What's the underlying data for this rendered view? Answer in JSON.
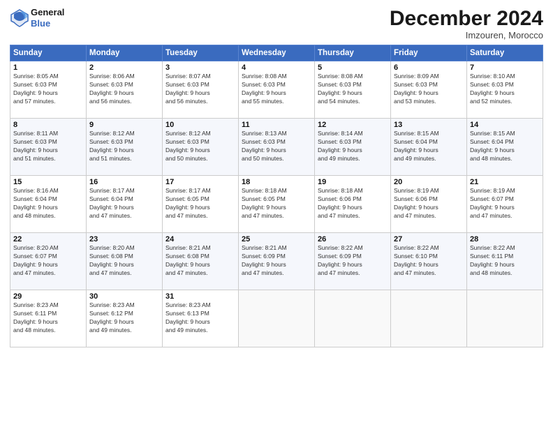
{
  "header": {
    "logo_line1": "General",
    "logo_line2": "Blue",
    "month": "December 2024",
    "location": "Imzouren, Morocco"
  },
  "weekdays": [
    "Sunday",
    "Monday",
    "Tuesday",
    "Wednesday",
    "Thursday",
    "Friday",
    "Saturday"
  ],
  "weeks": [
    [
      {
        "day": "1",
        "info": "Sunrise: 8:05 AM\nSunset: 6:03 PM\nDaylight: 9 hours\nand 57 minutes."
      },
      {
        "day": "2",
        "info": "Sunrise: 8:06 AM\nSunset: 6:03 PM\nDaylight: 9 hours\nand 56 minutes."
      },
      {
        "day": "3",
        "info": "Sunrise: 8:07 AM\nSunset: 6:03 PM\nDaylight: 9 hours\nand 56 minutes."
      },
      {
        "day": "4",
        "info": "Sunrise: 8:08 AM\nSunset: 6:03 PM\nDaylight: 9 hours\nand 55 minutes."
      },
      {
        "day": "5",
        "info": "Sunrise: 8:08 AM\nSunset: 6:03 PM\nDaylight: 9 hours\nand 54 minutes."
      },
      {
        "day": "6",
        "info": "Sunrise: 8:09 AM\nSunset: 6:03 PM\nDaylight: 9 hours\nand 53 minutes."
      },
      {
        "day": "7",
        "info": "Sunrise: 8:10 AM\nSunset: 6:03 PM\nDaylight: 9 hours\nand 52 minutes."
      }
    ],
    [
      {
        "day": "8",
        "info": "Sunrise: 8:11 AM\nSunset: 6:03 PM\nDaylight: 9 hours\nand 51 minutes."
      },
      {
        "day": "9",
        "info": "Sunrise: 8:12 AM\nSunset: 6:03 PM\nDaylight: 9 hours\nand 51 minutes."
      },
      {
        "day": "10",
        "info": "Sunrise: 8:12 AM\nSunset: 6:03 PM\nDaylight: 9 hours\nand 50 minutes."
      },
      {
        "day": "11",
        "info": "Sunrise: 8:13 AM\nSunset: 6:03 PM\nDaylight: 9 hours\nand 50 minutes."
      },
      {
        "day": "12",
        "info": "Sunrise: 8:14 AM\nSunset: 6:03 PM\nDaylight: 9 hours\nand 49 minutes."
      },
      {
        "day": "13",
        "info": "Sunrise: 8:15 AM\nSunset: 6:04 PM\nDaylight: 9 hours\nand 49 minutes."
      },
      {
        "day": "14",
        "info": "Sunrise: 8:15 AM\nSunset: 6:04 PM\nDaylight: 9 hours\nand 48 minutes."
      }
    ],
    [
      {
        "day": "15",
        "info": "Sunrise: 8:16 AM\nSunset: 6:04 PM\nDaylight: 9 hours\nand 48 minutes."
      },
      {
        "day": "16",
        "info": "Sunrise: 8:17 AM\nSunset: 6:04 PM\nDaylight: 9 hours\nand 47 minutes."
      },
      {
        "day": "17",
        "info": "Sunrise: 8:17 AM\nSunset: 6:05 PM\nDaylight: 9 hours\nand 47 minutes."
      },
      {
        "day": "18",
        "info": "Sunrise: 8:18 AM\nSunset: 6:05 PM\nDaylight: 9 hours\nand 47 minutes."
      },
      {
        "day": "19",
        "info": "Sunrise: 8:18 AM\nSunset: 6:06 PM\nDaylight: 9 hours\nand 47 minutes."
      },
      {
        "day": "20",
        "info": "Sunrise: 8:19 AM\nSunset: 6:06 PM\nDaylight: 9 hours\nand 47 minutes."
      },
      {
        "day": "21",
        "info": "Sunrise: 8:19 AM\nSunset: 6:07 PM\nDaylight: 9 hours\nand 47 minutes."
      }
    ],
    [
      {
        "day": "22",
        "info": "Sunrise: 8:20 AM\nSunset: 6:07 PM\nDaylight: 9 hours\nand 47 minutes."
      },
      {
        "day": "23",
        "info": "Sunrise: 8:20 AM\nSunset: 6:08 PM\nDaylight: 9 hours\nand 47 minutes."
      },
      {
        "day": "24",
        "info": "Sunrise: 8:21 AM\nSunset: 6:08 PM\nDaylight: 9 hours\nand 47 minutes."
      },
      {
        "day": "25",
        "info": "Sunrise: 8:21 AM\nSunset: 6:09 PM\nDaylight: 9 hours\nand 47 minutes."
      },
      {
        "day": "26",
        "info": "Sunrise: 8:22 AM\nSunset: 6:09 PM\nDaylight: 9 hours\nand 47 minutes."
      },
      {
        "day": "27",
        "info": "Sunrise: 8:22 AM\nSunset: 6:10 PM\nDaylight: 9 hours\nand 47 minutes."
      },
      {
        "day": "28",
        "info": "Sunrise: 8:22 AM\nSunset: 6:11 PM\nDaylight: 9 hours\nand 48 minutes."
      }
    ],
    [
      {
        "day": "29",
        "info": "Sunrise: 8:23 AM\nSunset: 6:11 PM\nDaylight: 9 hours\nand 48 minutes."
      },
      {
        "day": "30",
        "info": "Sunrise: 8:23 AM\nSunset: 6:12 PM\nDaylight: 9 hours\nand 49 minutes."
      },
      {
        "day": "31",
        "info": "Sunrise: 8:23 AM\nSunset: 6:13 PM\nDaylight: 9 hours\nand 49 minutes."
      },
      null,
      null,
      null,
      null
    ]
  ]
}
